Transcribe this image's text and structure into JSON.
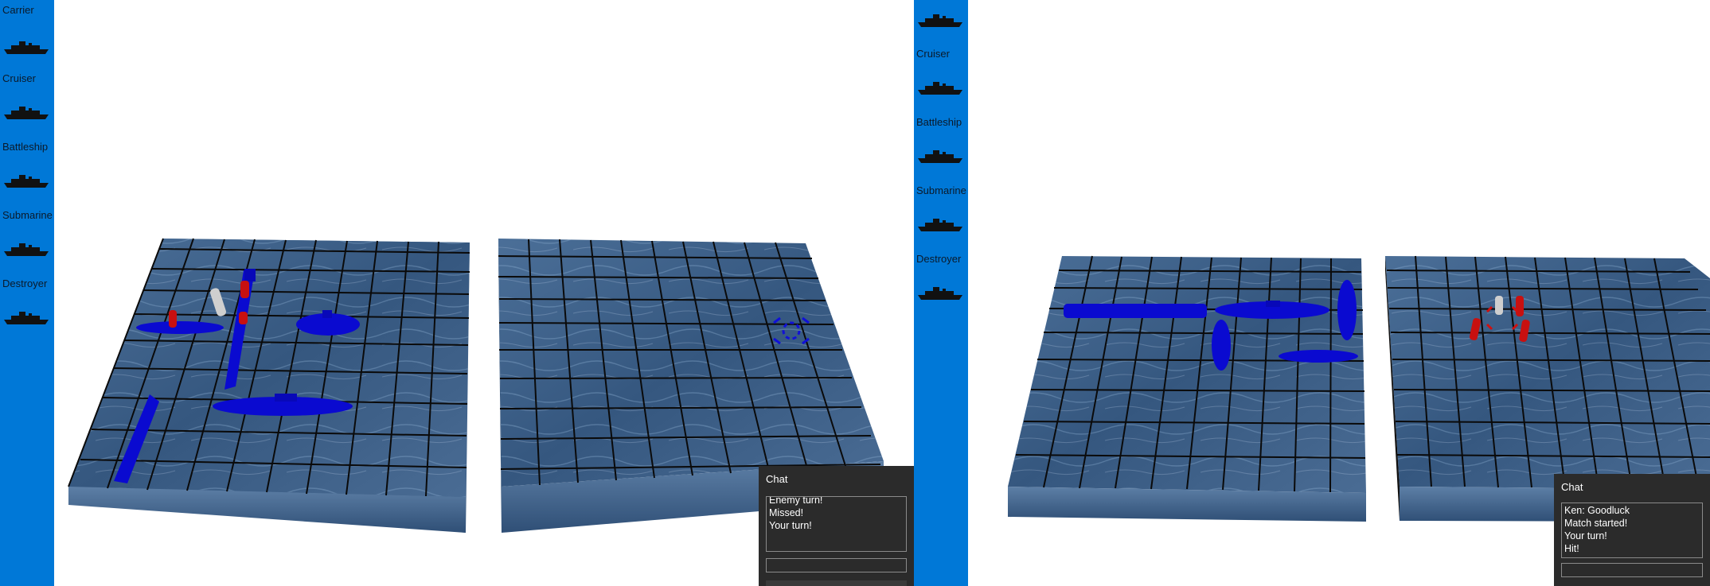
{
  "left_window": {
    "sidebar": {
      "items": [
        {
          "label": "Carrier",
          "icon": "carrier-silhouette-icon"
        },
        {
          "label": "Cruiser",
          "icon": "cruiser-silhouette-icon"
        },
        {
          "label": "Battleship",
          "icon": "battleship-silhouette-icon"
        },
        {
          "label": "Submarine",
          "icon": "submarine-silhouette-icon"
        },
        {
          "label": "Destroyer",
          "icon": "destroyer-silhouette-icon"
        }
      ]
    },
    "chat": {
      "title": "Chat",
      "messages": [
        "Enemy turn!",
        "Missed!",
        "Your turn!"
      ],
      "input_value": ""
    }
  },
  "right_window": {
    "sidebar": {
      "items": [
        {
          "label": "",
          "icon": "carrier-silhouette-icon"
        },
        {
          "label": "Cruiser",
          "icon": "cruiser-silhouette-icon"
        },
        {
          "label": "Battleship",
          "icon": "battleship-silhouette-icon"
        },
        {
          "label": "Submarine",
          "icon": "submarine-silhouette-icon"
        },
        {
          "label": "Destroyer",
          "icon": "destroyer-silhouette-icon"
        }
      ]
    },
    "chat": {
      "title": "Chat",
      "messages": [
        "Ken: Goodluck",
        "Match started!",
        "Your turn!",
        "Hit!"
      ],
      "input_value": ""
    }
  },
  "colors": {
    "sidebar": "#0078d7",
    "ship": "#0a0ad0",
    "hit_peg": "#c81010",
    "miss_peg": "#cfcfcf",
    "water": "#3e5f86",
    "grid": "#0a0a0a",
    "chat_bg": "#2b2b2b"
  }
}
